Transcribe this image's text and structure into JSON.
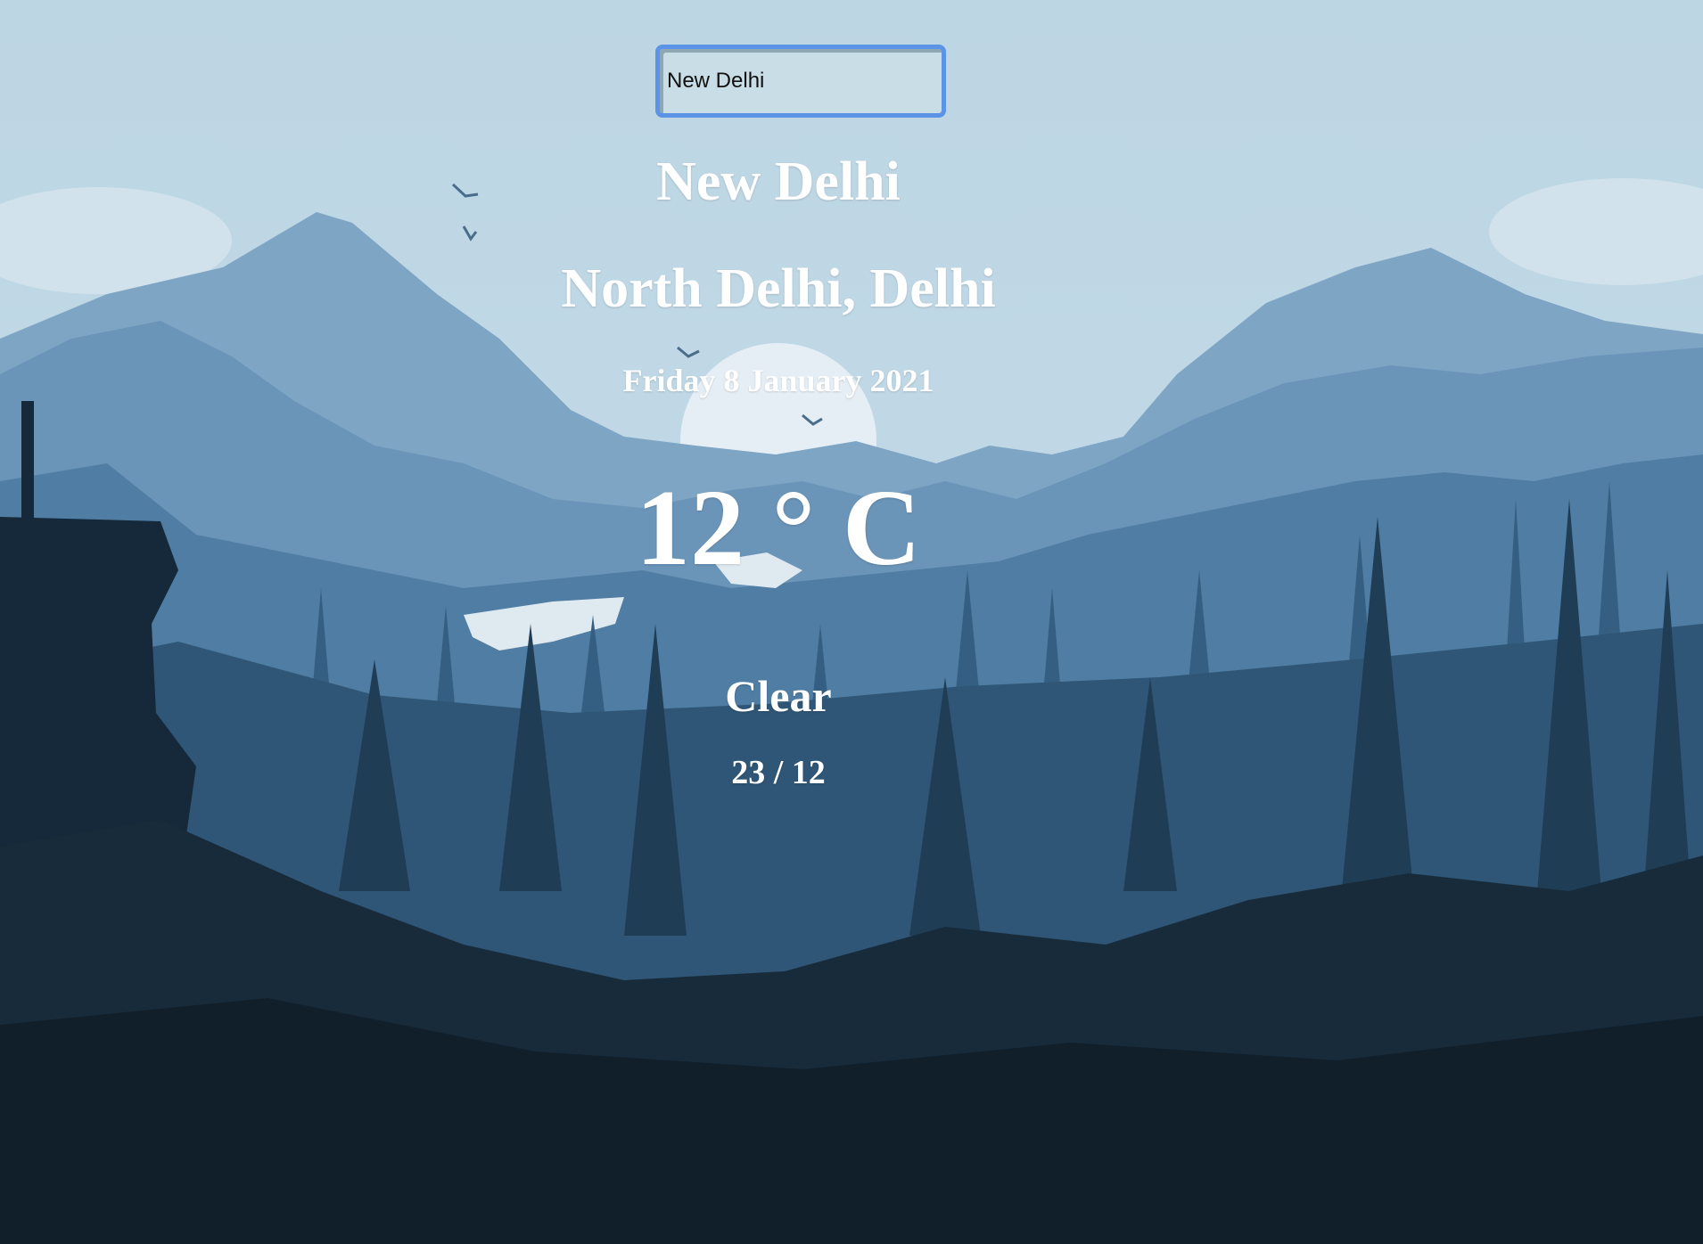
{
  "search": {
    "value": "New Delhi"
  },
  "weather": {
    "city": "New Delhi",
    "region": "North Delhi, Delhi",
    "date": "Friday 8 January 2021",
    "temperature": "12 ° C",
    "condition": "Clear",
    "high_low": "23 / 12"
  },
  "background": {
    "scene": "mountain-forest-landscape",
    "sky_color": "#bcd5e3",
    "focus_color": "#5b93e6"
  }
}
